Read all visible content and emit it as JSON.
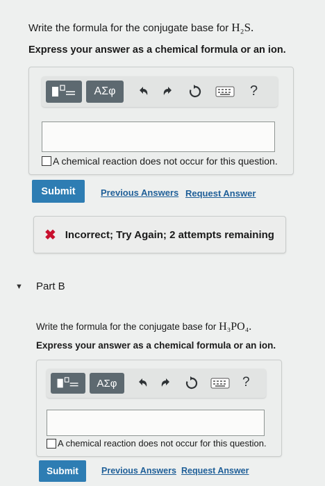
{
  "part_a": {
    "question_prefix": "Write the formula for the conjugate base for ",
    "question_formula": "H₂S.",
    "instruction": "Express your answer as a chemical formula or an ion.",
    "toolbar": {
      "template_icon": "fraction-template-icon",
      "greek_label": "ΑΣφ",
      "undo_icon": "undo-icon",
      "redo_icon": "redo-icon",
      "reset_icon": "reset-icon",
      "keyboard_icon": "keyboard-icon",
      "help_label": "?"
    },
    "answer_value": "",
    "no_reaction_label": "A chemical reaction does not occur for this question.",
    "submit_label": "Submit",
    "previous_answers_label": "Previous Answers",
    "request_answer_label": "Request Answer",
    "feedback": {
      "icon": "x-mark-icon",
      "icon_color": "#c8102e",
      "text": "Incorrect; Try Again; 2 attempts remaining"
    }
  },
  "part_b": {
    "title": "Part B",
    "question_prefix": "Write the formula for the conjugate base for ",
    "question_formula": "H₃PO₄.",
    "instruction": "Express your answer as a chemical formula or an ion.",
    "toolbar": {
      "template_icon": "fraction-template-icon",
      "greek_label": "ΑΣφ",
      "undo_icon": "undo-icon",
      "redo_icon": "redo-icon",
      "reset_icon": "reset-icon",
      "keyboard_icon": "keyboard-icon",
      "help_label": "?"
    },
    "answer_value": "",
    "no_reaction_label": "A chemical reaction does not occur for this question.",
    "submit_label": "Submit",
    "previous_answers_label": "Previous Answers",
    "request_answer_label": "Request Answer"
  },
  "colors": {
    "submit": "#2e7db3",
    "link": "#1f5f98",
    "toolbar_button": "#5d6970"
  }
}
